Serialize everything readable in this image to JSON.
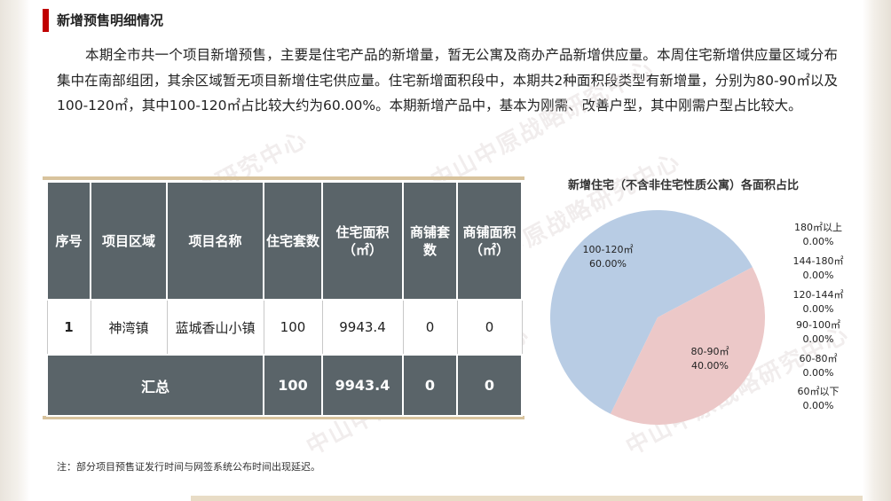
{
  "section_title": "新增预售明细情况",
  "paragraph": "本期全市共一个项目新增预售，主要是住宅产品的新增量，暂无公寓及商办产品新增供应量。本周住宅新增供应量区域分布集中在南部组团，其余区域暂无项目新增住宅供应量。住宅新增面积段中，本期共2种面积段类型有新增量，分别为80-90㎡以及100-120㎡，其中100-120㎡占比较大约为60.00%。本期新增产品中，基本为刚需、改善户型，其中刚需户型占比较大。",
  "table": {
    "headers": [
      "序号",
      "项目区域",
      "项目名称",
      "住宅套数",
      "住宅面积（㎡）",
      "商铺套数",
      "商铺面积（㎡）"
    ],
    "rows": [
      [
        "1",
        "神湾镇",
        "蓝城香山小镇",
        "100",
        "9943.4",
        "0",
        "0"
      ]
    ],
    "total": {
      "label": "汇总",
      "units": "100",
      "area": "9943.4",
      "shop_units": "0",
      "shop_area": "0"
    }
  },
  "note": "注：部分项目预售证发行时间与网签系统公布时间出现延迟。",
  "watermark": "中山中原战略研究中心",
  "colors": {
    "accent": "#c00000",
    "table_header": "#5a6469",
    "slice_blue": "#b8cce4",
    "slice_pink": "#ecc8c8",
    "rule": "#d8c39d"
  },
  "chart_data": {
    "type": "pie",
    "title": "新增住宅（不含非住宅性质公寓）各面积占比",
    "slices": [
      {
        "label": "100-120㎡",
        "value": 60.0,
        "display": "60.00%",
        "color": "#b8cce4"
      },
      {
        "label": "80-90㎡",
        "value": 40.0,
        "display": "40.00%",
        "color": "#ecc8c8"
      }
    ],
    "zero_categories": [
      {
        "label": "180㎡以上",
        "display": "0.00%"
      },
      {
        "label": "144-180㎡",
        "display": "0.00%"
      },
      {
        "label": "120-144㎡",
        "display": "0.00%"
      },
      {
        "label": "90-100㎡",
        "display": "0.00%"
      },
      {
        "label": "60-80㎡",
        "display": "0.00%"
      },
      {
        "label": "60㎡以下",
        "display": "0.00%"
      }
    ]
  }
}
